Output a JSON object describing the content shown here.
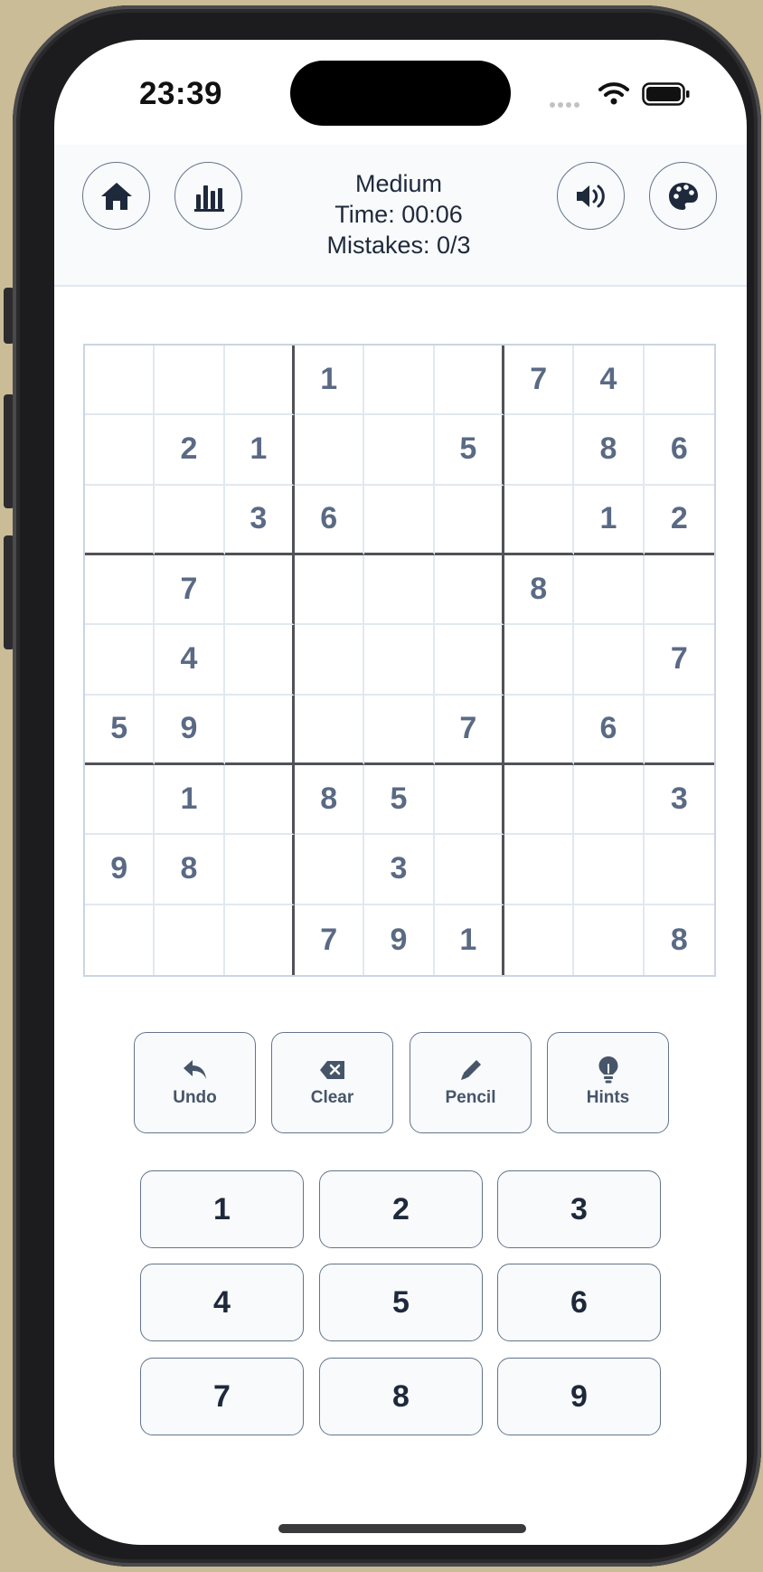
{
  "status_bar": {
    "time": "23:39"
  },
  "header": {
    "difficulty": "Medium",
    "timer": "Time: 00:06",
    "mistakes": "Mistakes: 0/3"
  },
  "board": {
    "rows": [
      [
        "",
        "",
        "",
        "1",
        "",
        "",
        "7",
        "4",
        ""
      ],
      [
        "",
        "2",
        "1",
        "",
        "",
        "5",
        "",
        "8",
        "6"
      ],
      [
        "",
        "",
        "3",
        "6",
        "",
        "",
        "",
        "1",
        "2"
      ],
      [
        "",
        "7",
        "",
        "",
        "",
        "",
        "8",
        "",
        ""
      ],
      [
        "",
        "4",
        "",
        "",
        "",
        "",
        "",
        "",
        "7"
      ],
      [
        "5",
        "9",
        "",
        "",
        "",
        "7",
        "",
        "6",
        ""
      ],
      [
        "",
        "1",
        "",
        "8",
        "5",
        "",
        "",
        "",
        "3"
      ],
      [
        "9",
        "8",
        "",
        "",
        "3",
        "",
        "",
        "",
        ""
      ],
      [
        "",
        "",
        "",
        "7",
        "9",
        "1",
        "",
        "",
        "8"
      ]
    ]
  },
  "tools": [
    {
      "label": "Undo",
      "icon": "undo-icon"
    },
    {
      "label": "Clear",
      "icon": "backspace-icon"
    },
    {
      "label": "Pencil",
      "icon": "pencil-icon"
    },
    {
      "label": "Hints",
      "icon": "lightbulb-icon"
    }
  ],
  "numpad": [
    "1",
    "2",
    "3",
    "4",
    "5",
    "6",
    "7",
    "8",
    "9"
  ],
  "colors": {
    "given_digit": "#5a6a85",
    "button_border": "#64748b",
    "header_bg": "#f8fafc",
    "text_dark": "#1e293b"
  }
}
